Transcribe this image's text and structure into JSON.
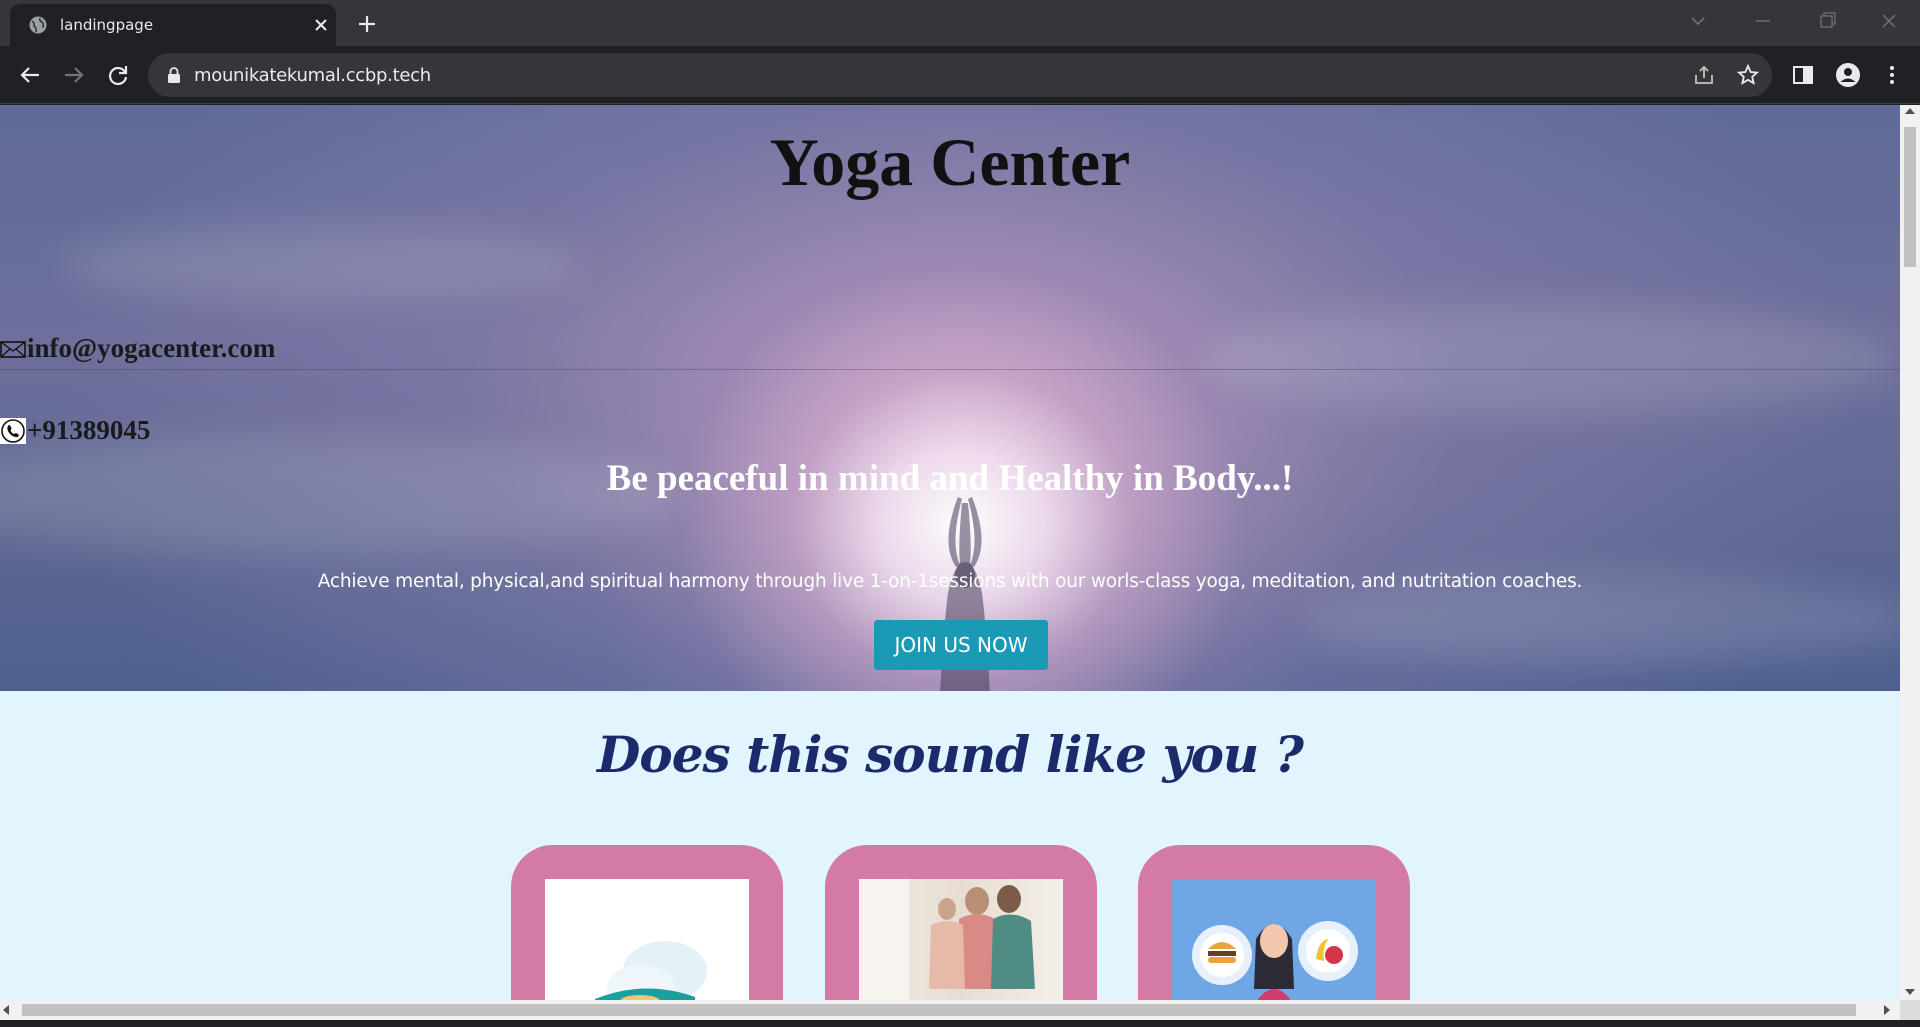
{
  "browser": {
    "tab_title": "landingpage",
    "url": "mounikatekumal.ccbp.tech"
  },
  "header": {
    "title": "Yoga Center",
    "email": "info@yogacenter.com",
    "phone": "+91389045"
  },
  "hero": {
    "headline": "Be peaceful in mind and Healthy in Body...!",
    "description": "Achieve mental, physical,and spiritual harmony through live 1-on-1sessions with our worls-class yoga, meditation, and nutritation coaches.",
    "cta_label": "JOIN US NOW"
  },
  "section": {
    "heading": "Does this sound like you ?"
  },
  "colors": {
    "cta": "#1b9ab5",
    "card": "#d47aa6",
    "section_bg": "#e2f4fd",
    "heading": "#1b2a6b"
  }
}
